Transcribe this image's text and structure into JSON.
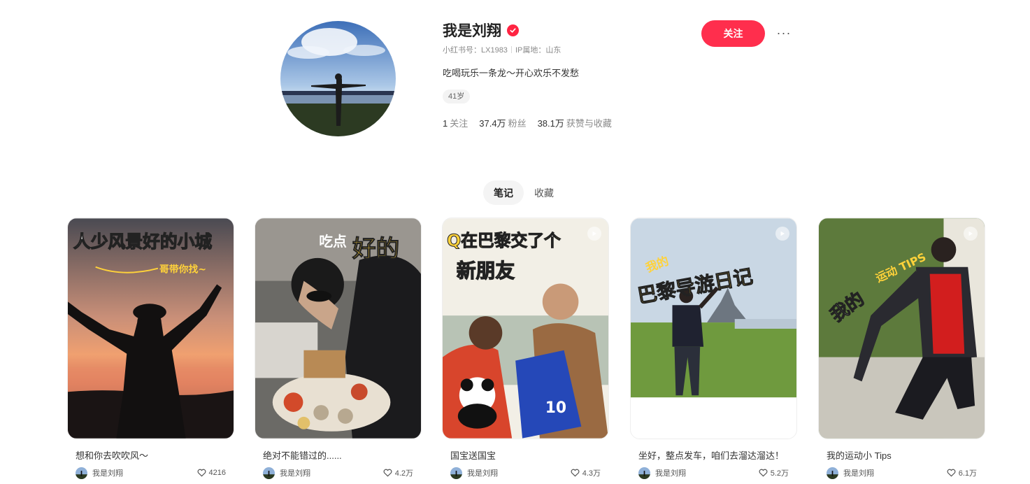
{
  "profile": {
    "name": "我是刘翔",
    "red_id": "小红书号：LX1983",
    "ip_location": "IP属地：山东",
    "bio": "吃喝玩乐一条龙～开心欢乐不发愁",
    "age_tag": "41岁",
    "stats": {
      "following_count": "1",
      "following_label": "关注",
      "fans_count": "37.4万",
      "fans_label": "粉丝",
      "likes_count": "38.1万",
      "likes_label": "获赞与收藏"
    },
    "follow_label": "关注",
    "more_label": "···"
  },
  "tabs": [
    {
      "label": "笔记",
      "active": true
    },
    {
      "label": "收藏",
      "active": false
    }
  ],
  "notes": [
    {
      "title": "想和你去吹吹风～",
      "author": "我是刘翔",
      "likes": "4216",
      "cover_text_1": "人少风景好的小城",
      "cover_text_2": "哥带你找~",
      "has_play": false
    },
    {
      "title": "绝对不能错过的......",
      "author": "我是刘翔",
      "likes": "4.2万",
      "cover_text_1": "吃点",
      "cover_text_2": "好的",
      "has_play": false
    },
    {
      "title": "国宝送国宝",
      "author": "我是刘翔",
      "likes": "4.3万",
      "cover_text_1": "Q在巴黎交了个",
      "cover_text_2": "新朋友",
      "has_play": true
    },
    {
      "title": "坐好，整点发车，咱们去溜达溜达！",
      "author": "我是刘翔",
      "likes": "5.2万",
      "cover_text_1": "我的",
      "cover_text_2": "巴黎导游日记",
      "has_play": true
    },
    {
      "title": "我的运动小 Tips",
      "author": "我是刘翔",
      "likes": "6.1万",
      "cover_text_1": "我的",
      "cover_text_2": "运动 TIPS",
      "has_play": true
    }
  ],
  "colors": {
    "brand": "#ff2e4d",
    "verified": "#ff2442"
  }
}
